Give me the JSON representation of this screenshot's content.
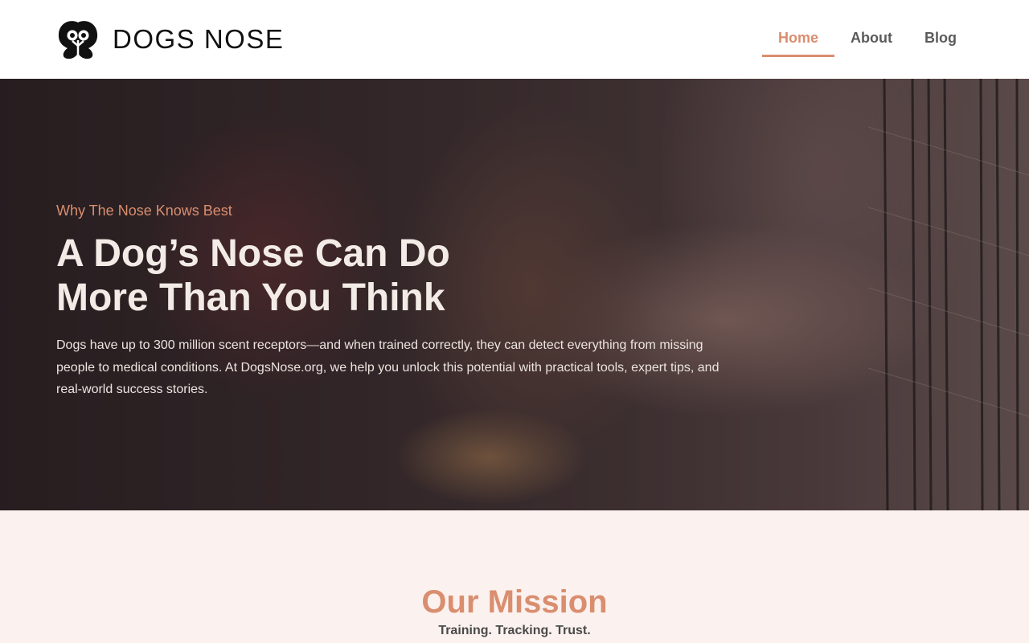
{
  "brand": {
    "name": "DOGS NOSE",
    "logo_icon": "dog-nose-logo-icon"
  },
  "nav": {
    "items": [
      {
        "label": "Home",
        "active": true
      },
      {
        "label": "About",
        "active": false
      },
      {
        "label": "Blog",
        "active": false
      }
    ]
  },
  "hero": {
    "kicker": "Why The Nose Knows Best",
    "title": "A Dog’s Nose Can Do More Than You Think",
    "text": "Dogs have up to 300 million scent receptors—and when trained correctly, they can detect everything from missing people to medical conditions. At DogsNose.org, we help you unlock this potential with practical tools, expert tips, and real-world success stories.",
    "image_description_icon": "puppy-behind-fence-photo"
  },
  "mission": {
    "title": "Our Mission",
    "subtitle": "Training. Tracking. Trust."
  },
  "colors": {
    "accent": "#d98e6f",
    "nav_text": "#5b5b5b",
    "mission_bg": "#fbf1ee",
    "hero_text": "#f3ebe6"
  }
}
